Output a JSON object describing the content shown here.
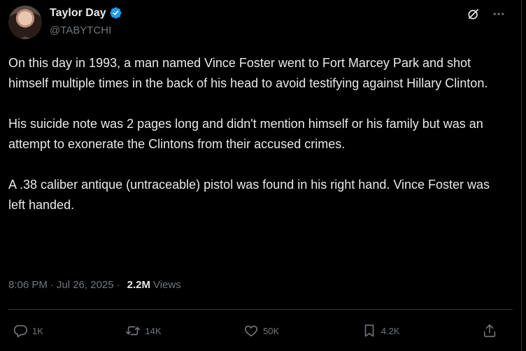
{
  "author": {
    "name": "Taylor Day",
    "handle": "@TABYTCHI",
    "verified": true
  },
  "post": {
    "paragraphs": [
      "On this day in 1993, a man named Vince Foster went to Fort Marcey Park and shot himself multiple times in the back of his head to avoid testifying against Hillary Clinton.",
      "His suicide note was 2 pages long and didn't mention himself or his family but was an attempt to exonerate the Clintons from their accused crimes.",
      "A .38 caliber antique (untraceable) pistol was found in his right hand. Vince Foster was left handed."
    ],
    "time": "8:06 PM",
    "separator": "·",
    "date": "Jul 26, 2025",
    "views_count": "2.2M",
    "views_label": "Views"
  },
  "actions": {
    "replies": "1K",
    "reposts": "14K",
    "likes": "50K",
    "bookmarks": "4.2K"
  },
  "colors": {
    "background": "#000000",
    "text": "#e7e9ea",
    "muted": "#71767b",
    "verified": "#1d9bf0",
    "divider": "#2f3336"
  },
  "icons": [
    "grok-icon",
    "more-icon",
    "reply-icon",
    "repost-icon",
    "like-icon",
    "bookmark-icon",
    "share-icon",
    "verified-badge-icon"
  ]
}
